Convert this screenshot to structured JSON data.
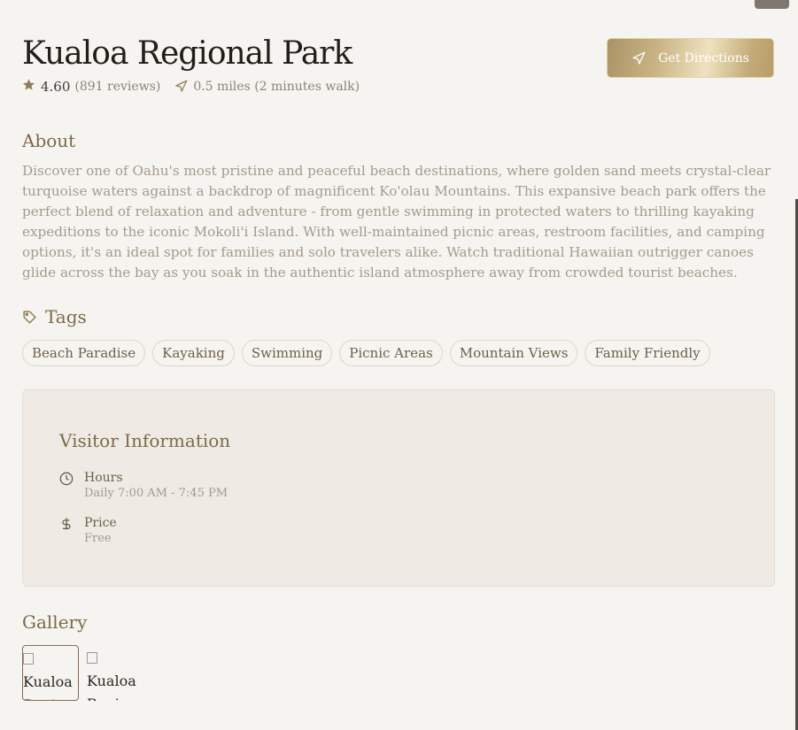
{
  "header": {
    "title": "Kualoa Regional Park",
    "rating": "4.60",
    "reviews": "(891 reviews)",
    "distance": "0.5 miles (2 minutes walk)",
    "directions_label": "Get Directions"
  },
  "about": {
    "heading": "About",
    "text": "Discover one of Oahu's most pristine and peaceful beach destinations, where golden sand meets crystal-clear turquoise waters against a backdrop of magnificent Ko'olau Mountains. This expansive beach park offers the perfect blend of relaxation and adventure - from gentle swimming in protected waters to thrilling kayaking expeditions to the iconic Mokoli'i Island. With well-maintained picnic areas, restroom facilities, and camping options, it's an ideal spot for families and solo travelers alike. Watch traditional Hawaiian outrigger canoes glide across the bay as you soak in the authentic island atmosphere away from crowded tourist beaches."
  },
  "tags": {
    "heading": "Tags",
    "items": [
      "Beach Paradise",
      "Kayaking",
      "Swimming",
      "Picnic Areas",
      "Mountain Views",
      "Family Friendly"
    ]
  },
  "visitor": {
    "heading": "Visitor Information",
    "hours_label": "Hours",
    "hours_value": "Daily 7:00 AM - 7:45 PM",
    "price_label": "Price",
    "price_value": "Free"
  },
  "gallery": {
    "heading": "Gallery",
    "images": [
      {
        "alt": "Kualoa Regional Park"
      },
      {
        "alt": "Kualoa Regional Park"
      }
    ]
  },
  "icons": {
    "star": "star-icon",
    "location": "navigation-arrow-icon",
    "tag": "tag-icon",
    "clock": "clock-icon",
    "dollar": "dollar-icon"
  },
  "colors": {
    "accent": "#7b6a48",
    "background": "#f6f4f0",
    "card": "#efebe4"
  }
}
